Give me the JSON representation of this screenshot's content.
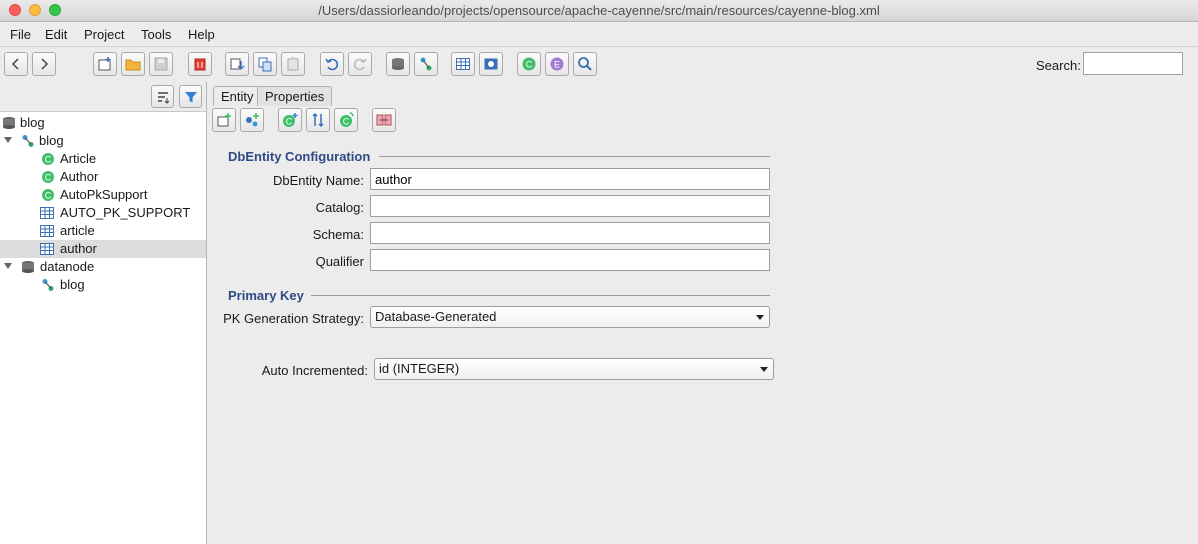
{
  "window": {
    "title": "/Users/dassiorleando/projects/opensource/apache-cayenne/src/main/resources/cayenne-blog.xml"
  },
  "menu": {
    "file": "File",
    "edit": "Edit",
    "project": "Project",
    "tools": "Tools",
    "help": "Help"
  },
  "toolbar": {
    "icons": [
      "back-icon",
      "forward-icon",
      "new-project-icon",
      "open-folder-icon",
      "save-icon",
      "delete-icon",
      "cut-icon",
      "copy-icon",
      "paste-icon",
      "undo-icon",
      "redo-icon",
      "datanode-icon",
      "datamap-icon",
      "table-icon",
      "procedure-icon",
      "objentity-icon",
      "embeddable-icon",
      "query-icon"
    ],
    "search_label": "Search:",
    "search_value": ""
  },
  "tree": {
    "items": [
      {
        "label": "blog",
        "icon": "domain-icon"
      },
      {
        "label": "blog",
        "icon": "datamap-icon"
      },
      {
        "label": "Article",
        "icon": "objentity-icon"
      },
      {
        "label": "Author",
        "icon": "objentity-icon"
      },
      {
        "label": "AutoPkSupport",
        "icon": "objentity-icon"
      },
      {
        "label": "AUTO_PK_SUPPORT",
        "icon": "table-icon"
      },
      {
        "label": "article",
        "icon": "table-icon"
      },
      {
        "label": "author",
        "icon": "table-icon"
      },
      {
        "label": "datanode",
        "icon": "datanode-icon"
      },
      {
        "label": "blog",
        "icon": "datamap-icon"
      }
    ]
  },
  "tabs": {
    "entity": "Entity",
    "properties": "Properties"
  },
  "config": {
    "section_title": "DbEntity Configuration",
    "name_label": "DbEntity Name:",
    "name_value": "author",
    "catalog_label": "Catalog:",
    "catalog_value": "",
    "schema_label": "Schema:",
    "schema_value": "",
    "qualifier_label": "Qualifier",
    "qualifier_value": ""
  },
  "pk": {
    "section_title": "Primary Key",
    "strategy_label": "PK Generation Strategy:",
    "strategy_value": "Database-Generated",
    "auto_label": "Auto Incremented:",
    "auto_value": "id (INTEGER)"
  },
  "colors": {
    "accent": "#2f4a86",
    "selection": "#dcdcdc",
    "objentity": "#3fbf6a",
    "table": "#3b6fb6"
  }
}
